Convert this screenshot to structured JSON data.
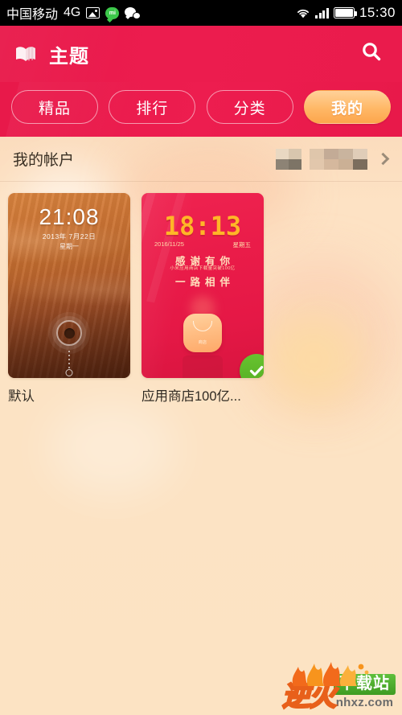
{
  "statusbar": {
    "carrier": "中国移动",
    "network": "4G",
    "icons": [
      "photo-icon",
      "mi-message-icon",
      "wechat-icon",
      "wifi-icon",
      "signal-icon",
      "battery-icon"
    ],
    "time": "15:30"
  },
  "header": {
    "title": "主题",
    "icon": "theme-book-icon",
    "search_icon": "search-icon",
    "background_color": "#ea1b4c"
  },
  "tabs": [
    {
      "label": "精品",
      "active": false
    },
    {
      "label": "排行",
      "active": false
    },
    {
      "label": "分类",
      "active": false
    },
    {
      "label": "我的",
      "active": true
    }
  ],
  "tab_active_color": "#ffb866",
  "account": {
    "label": "我的帐户",
    "value_masked": true,
    "chevron": "chevron-right-icon"
  },
  "themes": [
    {
      "name": "默认",
      "applied": false,
      "preview": {
        "style": "wood",
        "time": "21:08",
        "date": "2013年 7月22日",
        "weekday": "星期一",
        "lock_ring": "lock-ring-icon"
      }
    },
    {
      "name": "应用商店100亿...",
      "applied": true,
      "applied_icon": "check-circle-icon",
      "preview": {
        "style": "red",
        "time": "18:13",
        "date": "2016/11/25",
        "weekday": "星期五",
        "line1": "感谢有你",
        "line2": "小米应用商店下载量突破100亿",
        "line3": "一路相伴",
        "app_icon_label": "商店"
      }
    }
  ],
  "watermark": {
    "brand": "逆火",
    "tag": "下载站",
    "url": "nhxz.com"
  },
  "page_background": "#fce3c3"
}
